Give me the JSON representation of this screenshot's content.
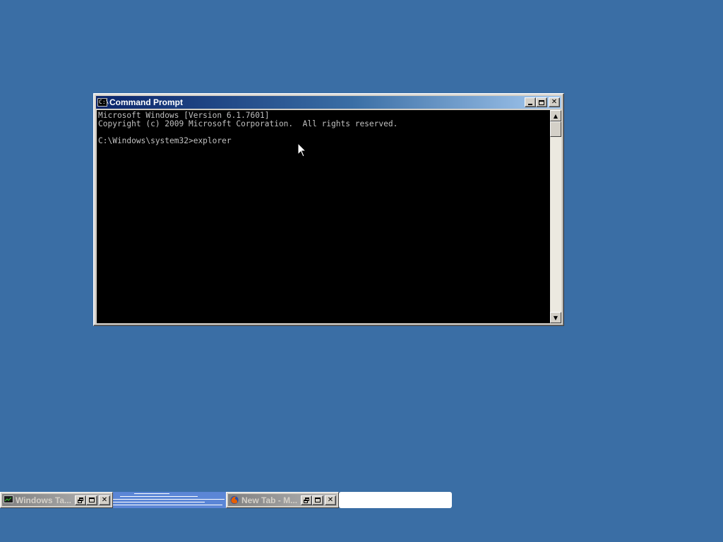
{
  "desktop": {
    "background_color": "#3a6ea5"
  },
  "cmd_window": {
    "title": "Command Prompt",
    "icon": "console-icon",
    "icon_label": "C:\\",
    "console_lines": [
      "Microsoft Windows [Version 6.1.7601]",
      "Copyright (c) 2009 Microsoft Corporation.  All rights reserved.",
      "",
      "C:\\Windows\\system32>explorer"
    ]
  },
  "minimized_windows": [
    {
      "title": "Windows Ta...",
      "icon": "task-manager-icon"
    },
    {
      "title": "New Tab - M...",
      "icon": "firefox-icon"
    }
  ],
  "colors": {
    "titlebar_active_start": "#0a246a",
    "titlebar_active_end": "#a6caf0",
    "titlebar_inactive": "#808080",
    "console_bg": "#000000",
    "console_fg": "#c0c0c0"
  }
}
